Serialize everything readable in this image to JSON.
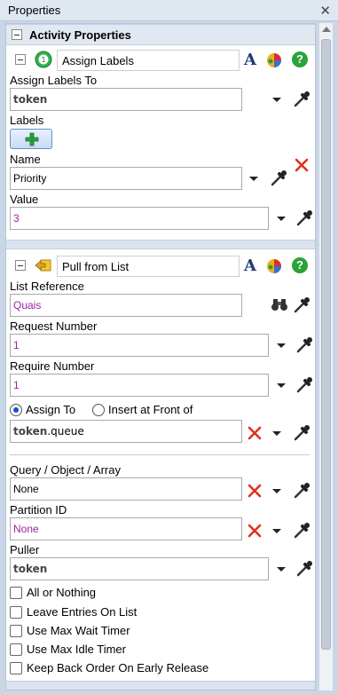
{
  "window": {
    "title": "Properties",
    "close_glyph": "✕"
  },
  "activity_properties": {
    "header": "Activity Properties"
  },
  "assign_labels": {
    "name": "Assign Labels",
    "icon_glyph": "⊗",
    "font_glyph": "A",
    "help_glyph": "?",
    "assign_to_label": "Assign Labels To",
    "assign_to_value": "token",
    "labels_label": "Labels",
    "name_label": "Name",
    "name_value": "Priority",
    "value_label": "Value",
    "value_value": "3"
  },
  "pull_from_list": {
    "name": "Pull from List",
    "font_glyph": "A",
    "help_glyph": "?",
    "list_ref_label": "List Reference",
    "list_ref_value": "Quais",
    "request_number_label": "Request Number",
    "request_number_value": "1",
    "require_number_label": "Require Number",
    "require_number_value": "1",
    "radio_assign_to": "Assign To",
    "radio_insert_front": "Insert at Front of",
    "assign_to_prefix": "token",
    "assign_to_suffix": ".queue",
    "query_label": "Query / Object / Array",
    "query_value": "None",
    "partition_label": "Partition ID",
    "partition_value": "None",
    "puller_label": "Puller",
    "puller_value": "token",
    "checkboxes": [
      "All or Nothing",
      "Leave Entries On List",
      "Use Max Wait Timer",
      "Use Max Idle Timer",
      "Keep Back Order On Early Release"
    ]
  },
  "icons": {
    "close": "close-icon",
    "collapse": "collapse-icon",
    "assign": "assign-labels-icon",
    "pull": "pull-from-list-icon",
    "font": "font-icon",
    "color": "color-icon",
    "help": "help-icon",
    "dropdown": "dropdown-arrow-icon",
    "eyedropper": "eyedropper-icon",
    "delete": "delete-x-icon",
    "binoculars": "binoculars-icon",
    "add": "add-plus-icon"
  },
  "colors": {
    "reference_text": "#444444",
    "number_text": "#a020a0",
    "delete_red": "#e0301e",
    "help_green": "#2aa338"
  }
}
